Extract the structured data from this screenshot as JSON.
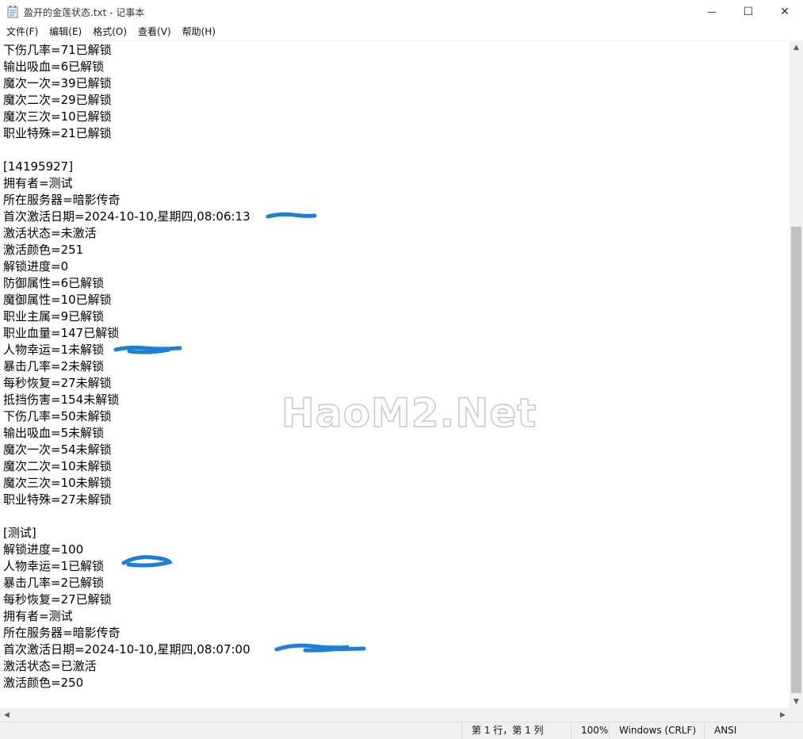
{
  "window": {
    "title": "盈开的金莲状态.txt - 记事本",
    "minimize_glyph": "—",
    "maximize_glyph": "☐",
    "close_glyph": "✕"
  },
  "menu": {
    "items": [
      {
        "label": "文件(F)"
      },
      {
        "label": "编辑(E)"
      },
      {
        "label": "格式(O)"
      },
      {
        "label": "查看(V)"
      },
      {
        "label": "帮助(H)"
      }
    ]
  },
  "editor": {
    "lines": [
      "下伤几率=71已解锁",
      "输出吸血=6已解锁",
      "魔次一次=39已解锁",
      "魔次二次=29已解锁",
      "魔次三次=10已解锁",
      "职业特殊=21已解锁",
      "",
      "[14195927]",
      "拥有者=测试",
      "所在服务器=暗影传奇",
      "首次激活日期=2024-10-10,星期四,08:06:13",
      "激活状态=未激活",
      "激活颜色=251",
      "解锁进度=0",
      "防御属性=6已解锁",
      "魔御属性=10已解锁",
      "职业主属=9已解锁",
      "职业血量=147已解锁",
      "人物幸运=1未解锁",
      "暴击几率=2未解锁",
      "每秒恢复=27未解锁",
      "抵挡伤害=154未解锁",
      "下伤几率=50未解锁",
      "输出吸血=5未解锁",
      "魔次一次=54未解锁",
      "魔次二次=10未解锁",
      "魔次三次=10未解锁",
      "职业特殊=27未解锁",
      "",
      "[测试]",
      "解锁进度=100",
      "人物幸运=1已解锁",
      "暴击几率=2已解锁",
      "每秒恢复=27已解锁",
      "拥有者=测试",
      "所在服务器=暗影传奇",
      "首次激活日期=2024-10-10,星期四,08:07:00",
      "激活状态=已激活",
      "激活颜色=250"
    ],
    "watermark": "HaoM2.Net",
    "scribble_color": "#1f7fd6"
  },
  "statusbar": {
    "position": "第 1 行，第 1 列",
    "zoom": "100%",
    "line_ending": "Windows (CRLF)",
    "encoding": "ANSI"
  },
  "icons": {
    "app": "notepad-icon",
    "scroll_up": "▲",
    "scroll_down": "▼",
    "scroll_left": "◀",
    "scroll_right": "▶"
  }
}
